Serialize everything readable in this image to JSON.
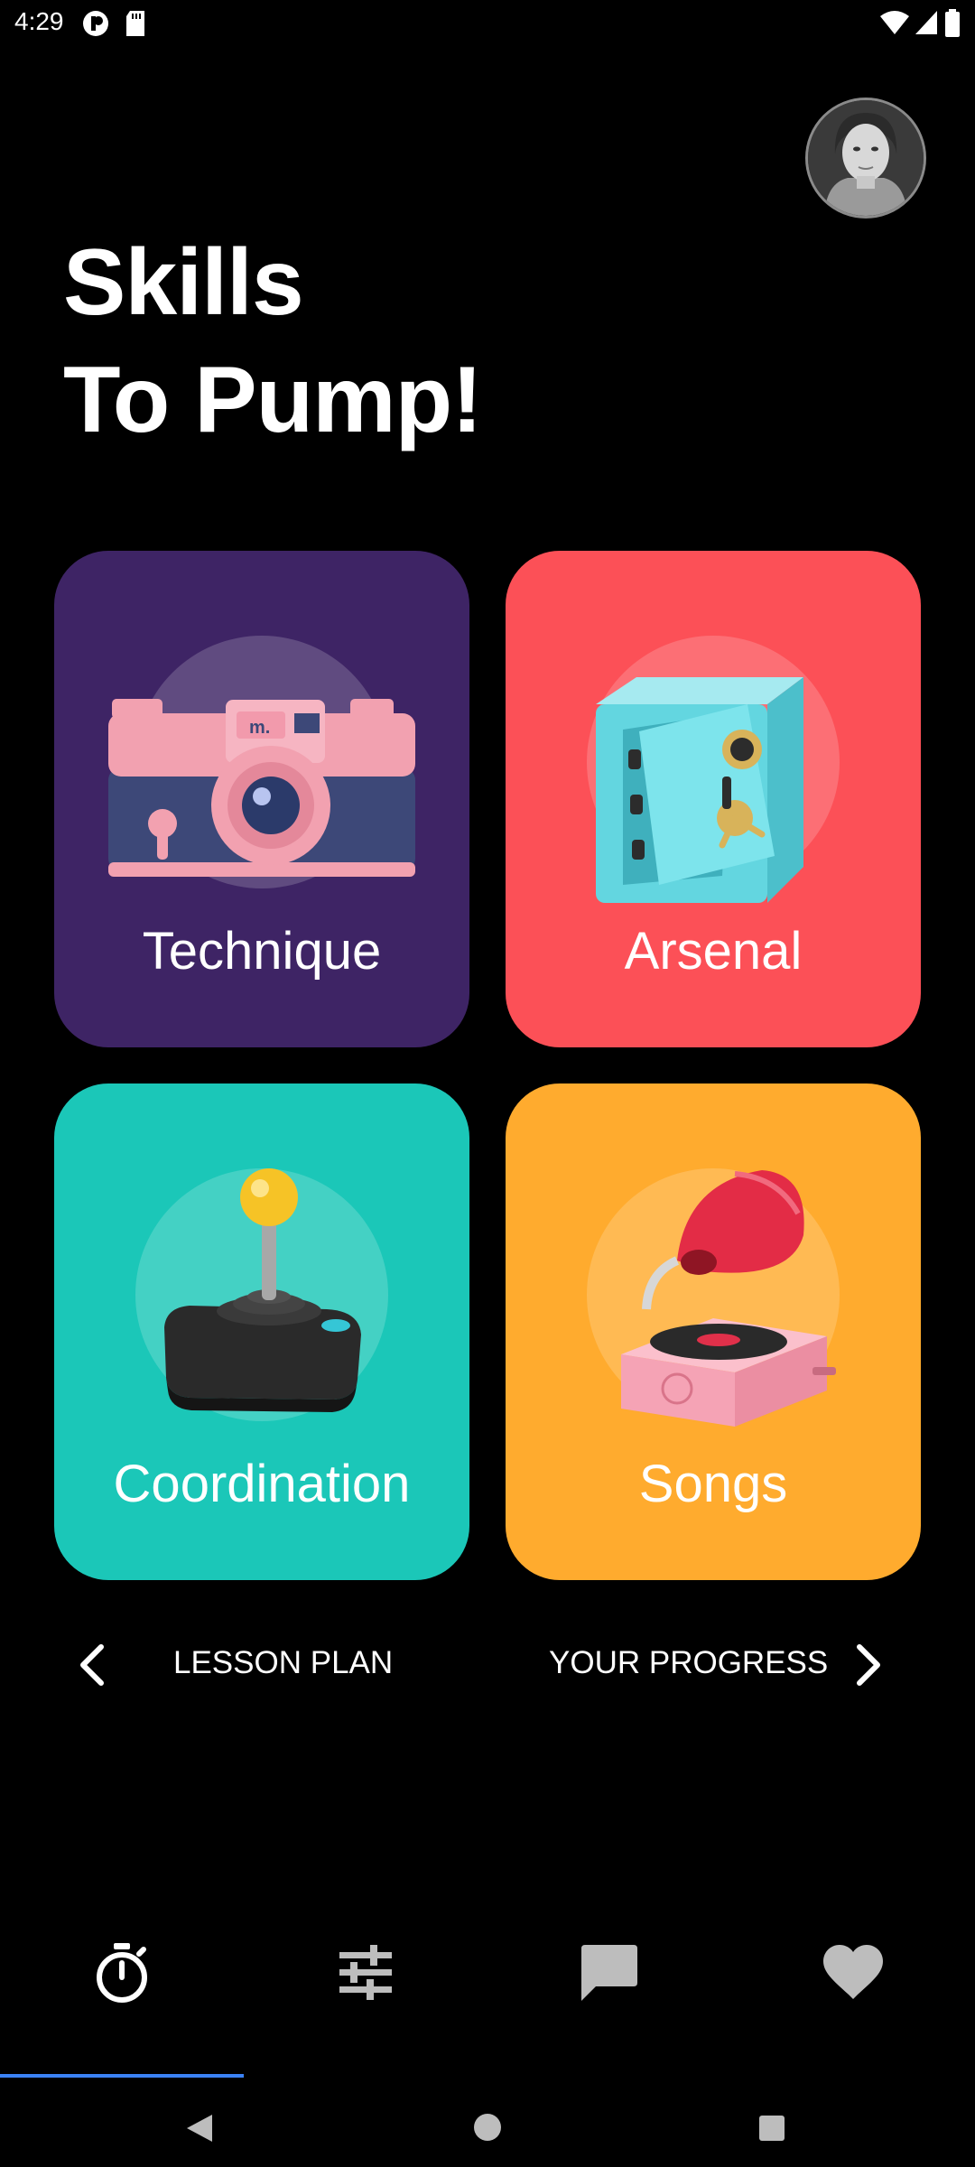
{
  "status_bar": {
    "time": "4:29"
  },
  "header": {
    "title_line1": "Skills",
    "title_line2": "To Pump!"
  },
  "cards": [
    {
      "label": "Technique",
      "color": "#3e2465",
      "icon": "camera-icon"
    },
    {
      "label": "Arsenal",
      "color": "#fc5057",
      "icon": "safe-icon"
    },
    {
      "label": "Coordination",
      "color": "#1bc7b8",
      "icon": "joystick-icon"
    },
    {
      "label": "Songs",
      "color": "#ffab2e",
      "icon": "gramophone-icon"
    }
  ],
  "nav": {
    "left_label": "LESSON PLAN",
    "right_label": "YOUR PROGRESS"
  },
  "tabs": [
    {
      "icon": "timer-icon",
      "active": true
    },
    {
      "icon": "sliders-icon",
      "active": false
    },
    {
      "icon": "chat-icon",
      "active": false
    },
    {
      "icon": "heart-icon",
      "active": false
    }
  ],
  "accent_color": "#3b82f6"
}
